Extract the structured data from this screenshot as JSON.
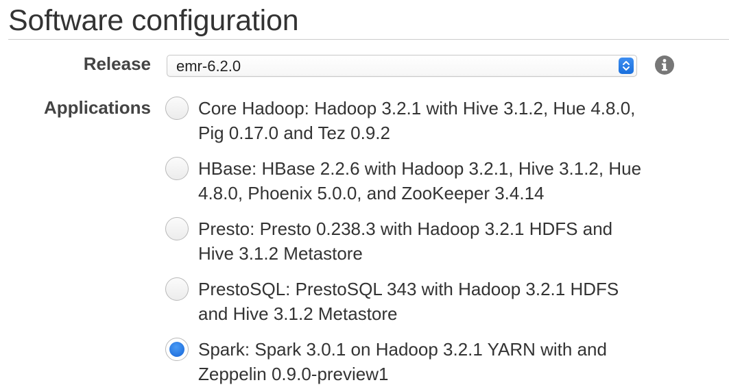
{
  "section": {
    "title": "Software configuration"
  },
  "release": {
    "label": "Release",
    "selected_value": "emr-6.2.0",
    "info_icon": "info-icon"
  },
  "applications": {
    "label": "Applications",
    "options": [
      {
        "text": "Core Hadoop: Hadoop 3.2.1 with Hive 3.1.2, Hue 4.8.0, Pig 0.17.0 and Tez 0.9.2",
        "selected": false
      },
      {
        "text": "HBase: HBase 2.2.6 with Hadoop 3.2.1, Hive 3.1.2, Hue 4.8.0, Phoenix 5.0.0, and ZooKeeper 3.4.14",
        "selected": false
      },
      {
        "text": "Presto: Presto 0.238.3 with Hadoop 3.2.1 HDFS and Hive 3.1.2 Metastore",
        "selected": false
      },
      {
        "text": "PrestoSQL: PrestoSQL 343 with Hadoop 3.2.1 HDFS and Hive 3.1.2 Metastore",
        "selected": false
      },
      {
        "text": "Spark: Spark 3.0.1 on Hadoop 3.2.1 YARN with and Zeppelin 0.9.0-preview1",
        "selected": true
      }
    ]
  },
  "colors": {
    "accent": "#1a6fdc",
    "text": "#333333",
    "label": "#444444"
  }
}
